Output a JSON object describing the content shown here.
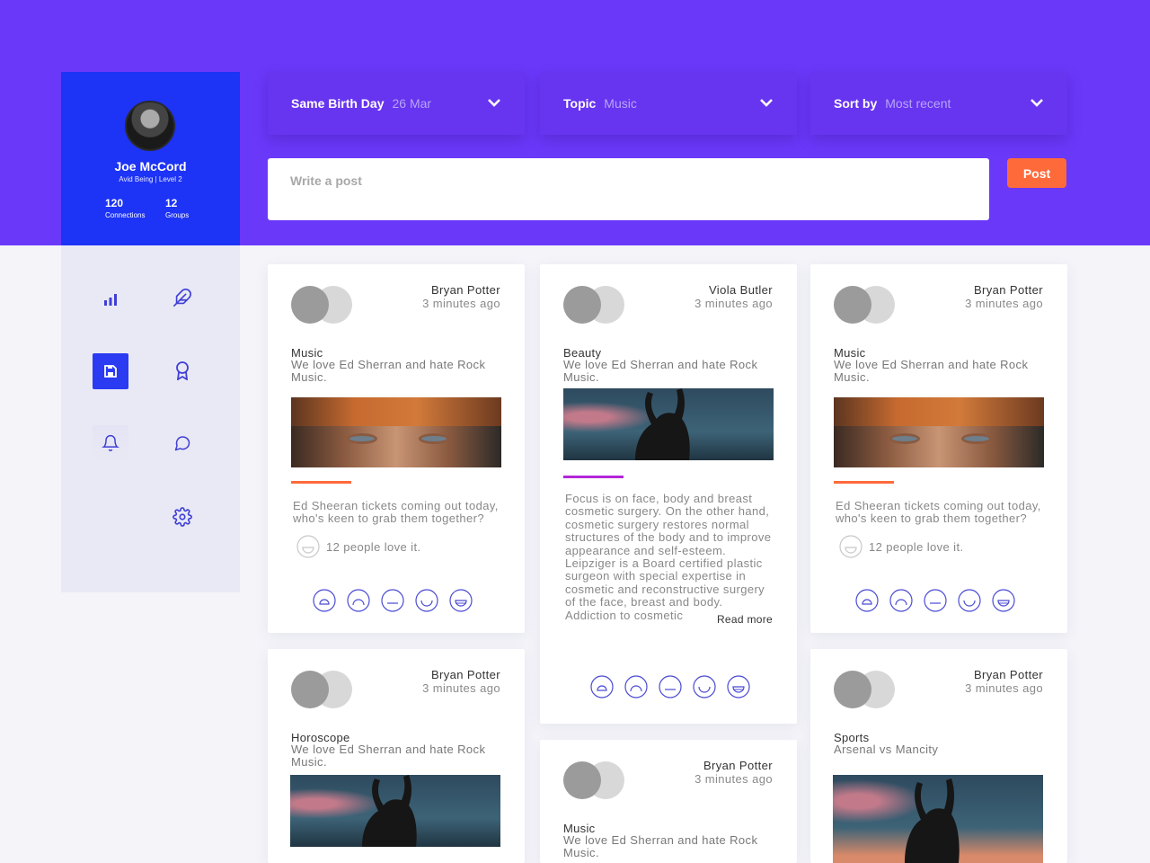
{
  "profile": {
    "name": "Joe McCord",
    "subtitle": "Avid Being | Level 2",
    "stats": [
      {
        "value": "120",
        "label": "Connections"
      },
      {
        "value": "12",
        "label": "Groups"
      }
    ]
  },
  "sidebar": {
    "icons": [
      "bar-chart-icon",
      "feather-icon",
      "save-icon",
      "award-icon",
      "bell-icon",
      "chat-icon",
      "gear-icon"
    ]
  },
  "filters": [
    {
      "label": "Same Birth Day",
      "value": "26 Mar"
    },
    {
      "label": "Topic",
      "value": "Music"
    },
    {
      "label": "Sort by",
      "value": "Most recent"
    }
  ],
  "composer": {
    "placeholder": "Write a post",
    "button": "Post"
  },
  "colors": {
    "hero": "#6a38f9",
    "profile": "#1d33f5",
    "post_button": "#ff6a3a",
    "accent_orange": "#ff6a3a",
    "accent_purple": "#b226d8"
  },
  "cards": [
    {
      "author": "Bryan Potter",
      "time": "3 minutes ago",
      "topic": "Music",
      "desc": "We love Ed Sherran and hate Rock Music.",
      "text": "Ed Sheeran tickets coming out today, who's keen to grab them together?",
      "love": "12 people love it."
    },
    {
      "author": "Viola Butler",
      "time": "3 minutes ago",
      "topic": "Beauty",
      "desc": "We love Ed Sherran and hate Rock Music.",
      "text": "Focus is on face, body and breast cosmetic surgery. On the other hand, cosmetic surgery restores normal structures of the body and to improve appearance and self-esteem. Leipziger is a Board certified plastic surgeon with special expertise in cosmetic and reconstructive surgery of the face, breast and body. Addiction to cosmetic",
      "read_more": "Read more"
    },
    {
      "author": "Bryan Potter",
      "time": "3 minutes ago",
      "topic": "Music",
      "desc": "We love Ed Sherran and hate Rock Music.",
      "text": "Ed Sheeran tickets coming out today, who's keen to grab them together?",
      "love": "12 people love it."
    },
    {
      "author": "Bryan Potter",
      "time": "3 minutes ago",
      "topic": "Horoscope",
      "desc": "We love Ed Sherran and hate Rock Music."
    },
    {
      "author": "Bryan Potter",
      "time": "3 minutes ago",
      "topic": "Music",
      "desc": "We love Ed Sherran and hate Rock Music."
    },
    {
      "author": "Bryan Potter",
      "time": "3 minutes ago",
      "topic": "Sports",
      "desc": "Arsenal vs Mancity"
    }
  ],
  "reaction_icons": [
    "happy-face-icon",
    "sad-face-icon",
    "neutral-face-icon",
    "smile-face-icon",
    "laugh-face-icon"
  ]
}
